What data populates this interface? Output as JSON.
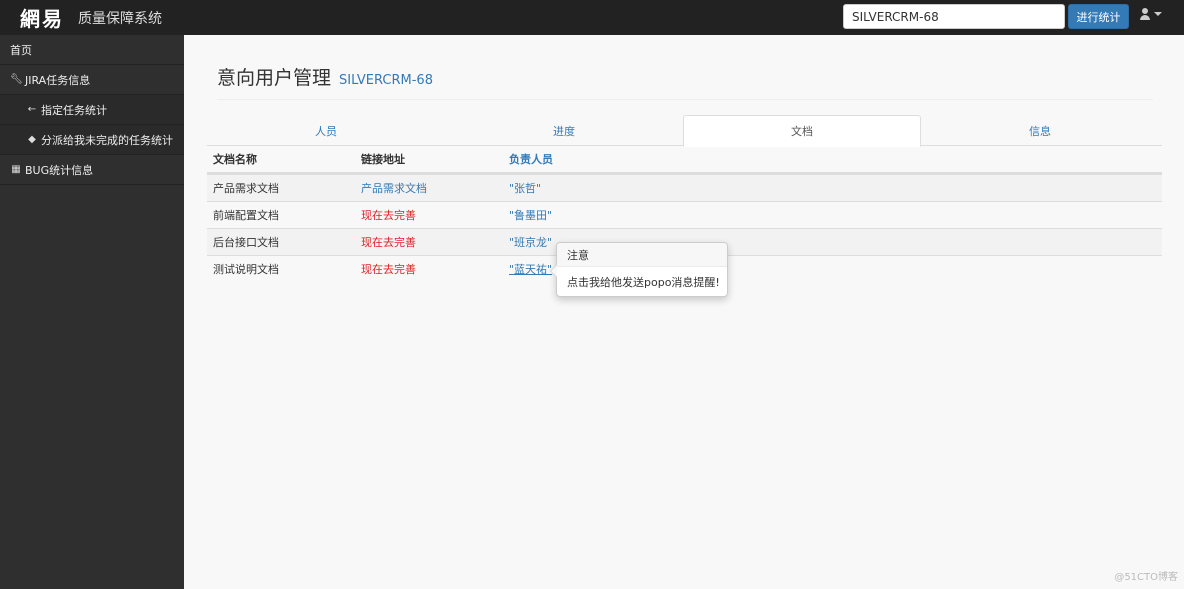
{
  "navbar": {
    "logo": "網易",
    "brand": "质量保障系统",
    "search_value": "SILVERCRM-68",
    "search_button": "进行统计",
    "user_icon": "user-icon"
  },
  "sidebar": {
    "items": [
      {
        "label": "首页",
        "icon": ""
      },
      {
        "label": "JIRA任务信息",
        "icon": "wrench-icon"
      },
      {
        "label": "指定任务统计",
        "icon": "arrow-left-icon"
      },
      {
        "label": "分派给我未完成的任务统计",
        "icon": "tag-icon"
      },
      {
        "label": "BUG统计信息",
        "icon": "table-icon"
      }
    ]
  },
  "page": {
    "title": "意向用户管理",
    "subtitle": "SILVERCRM-68"
  },
  "tabs": [
    {
      "label": "人员",
      "active": false
    },
    {
      "label": "进度",
      "active": false
    },
    {
      "label": "文档",
      "active": true
    },
    {
      "label": "信息",
      "active": false
    }
  ],
  "table": {
    "headers": [
      "文档名称",
      "链接地址",
      "负责人员"
    ],
    "rows": [
      {
        "name": "产品需求文档",
        "link": "产品需求文档",
        "link_color": "#337ab7",
        "person": "\"张哲\""
      },
      {
        "name": "前端配置文档",
        "link": "现在去完善",
        "link_color": "#e0222a",
        "person": "\"鲁墨田\""
      },
      {
        "name": "后台接口文档",
        "link": "现在去完善",
        "link_color": "#e0222a",
        "person": "\"班京龙\""
      },
      {
        "name": "测试说明文档",
        "link": "现在去完善",
        "link_color": "#e0222a",
        "person": "\"蓝天祐\""
      }
    ]
  },
  "popover": {
    "title": "注意",
    "body": "点击我给他发送popo消息提醒!"
  },
  "watermark": "@51CTO博客",
  "colors": {
    "accent": "#337ab7",
    "danger": "#e0222a",
    "navbar": "#222222",
    "sidebar": "#2f2f2f"
  }
}
